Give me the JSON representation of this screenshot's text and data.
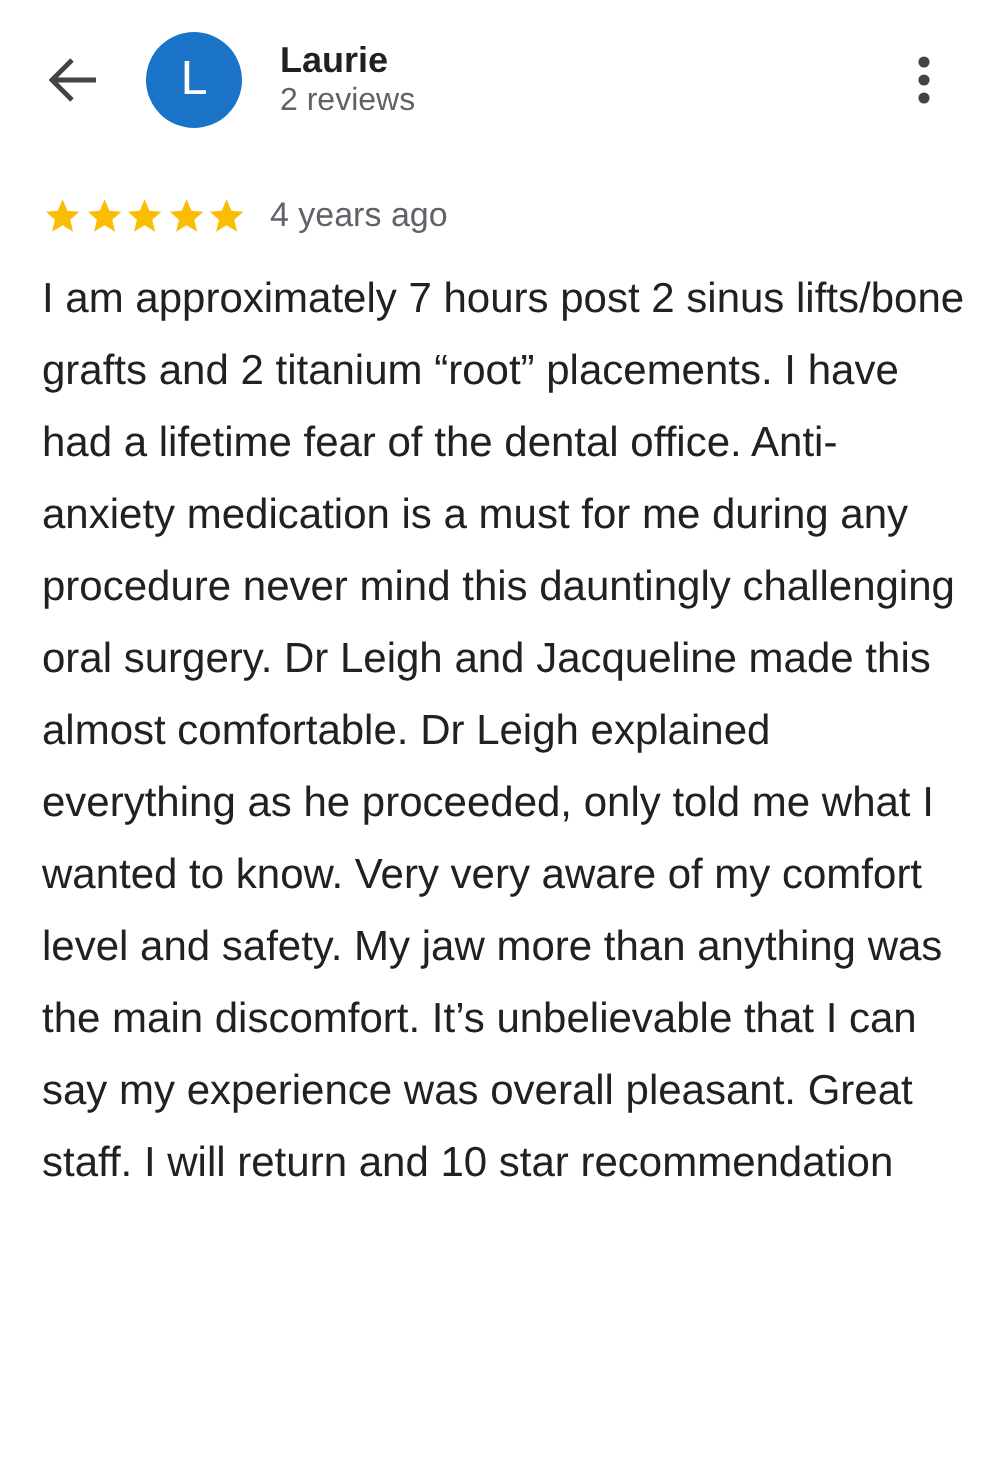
{
  "reviewer": {
    "initial": "L",
    "name": "Laurie",
    "review_count": "2 reviews"
  },
  "review": {
    "stars": 5,
    "time": "4 years ago",
    "text": "I am approximately 7 hours post 2 sinus lifts/bone grafts and 2 titanium “root” placements. I have had a lifetime fear of the dental office. Anti-anxiety medication is a must for me during any procedure never mind this dauntingly challenging oral surgery. Dr Leigh and Jacqueline made this almost comfortable. Dr Leigh explained everything as he proceeded, only told me what I wanted to know. Very very aware of my comfort level and safety. My jaw more than anything was the main discomfort. It’s unbelievable that I can say my experience was overall pleasant. Great staff. I will return and 10 star recommendation"
  }
}
